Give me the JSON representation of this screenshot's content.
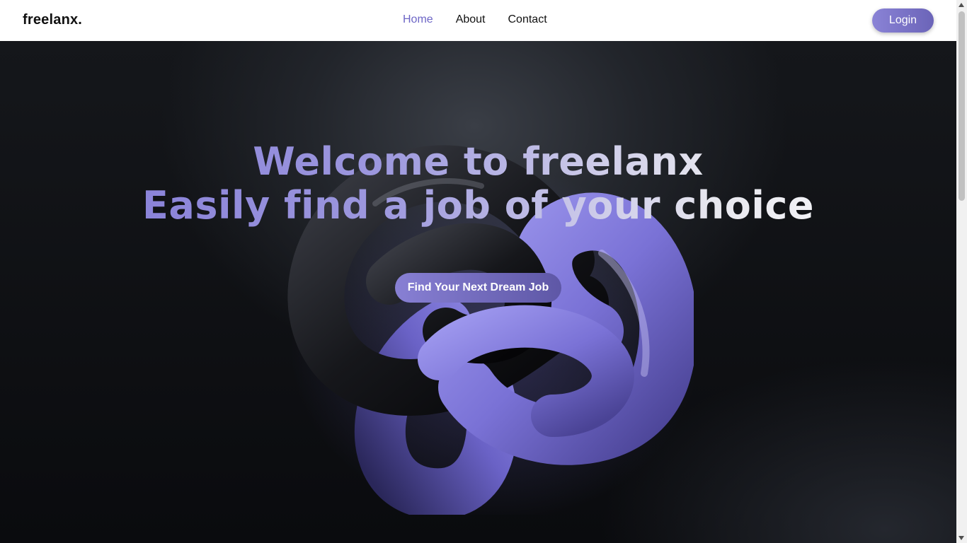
{
  "navbar": {
    "brand": "freelanx.",
    "links": [
      {
        "label": "Home",
        "active": true
      },
      {
        "label": "About",
        "active": false
      },
      {
        "label": "Contact",
        "active": false
      }
    ],
    "login_label": "Login"
  },
  "hero": {
    "title_line1": "Welcome to freelanx",
    "title_line2": "Easily find a job of your choice",
    "cta_label": "Find Your Next Dream Job"
  },
  "colors": {
    "accent": "#6d66c6",
    "button_gradient_start": "#8a83d6",
    "button_gradient_end": "#5e57a6",
    "hero_background": "#0b0c0f",
    "knot_purple": "#7c74d8",
    "knot_dark": "#1c1d22"
  },
  "icons": {
    "scroll_up": "scroll-up-arrow-icon",
    "scroll_down": "scroll-down-arrow-icon"
  }
}
